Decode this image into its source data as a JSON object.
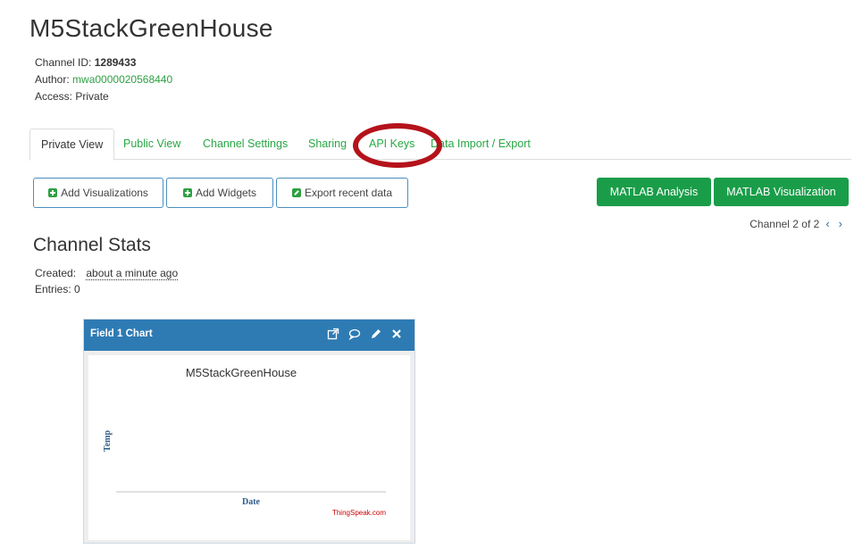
{
  "channel": {
    "title": "M5StackGreenHouse",
    "id_label": "Channel ID:",
    "id_value": "1289433",
    "author_label": "Author:",
    "author_value": "mwa0000020568440",
    "access_label": "Access:",
    "access_value": "Private"
  },
  "tabs": [
    {
      "label": "Private View",
      "active": true
    },
    {
      "label": "Public View"
    },
    {
      "label": "Channel Settings"
    },
    {
      "label": "Sharing"
    },
    {
      "label": "API Keys"
    },
    {
      "label": "Data Import / Export"
    }
  ],
  "toolbar": {
    "add_visualizations": "Add Visualizations",
    "add_widgets": "Add Widgets",
    "export_recent": "Export recent data",
    "matlab_analysis": "MATLAB Analysis",
    "matlab_visualization": "MATLAB Visualization"
  },
  "pager": {
    "text": "Channel 2 of 2",
    "prev_icon": "chevron-left-icon",
    "next_icon": "chevron-right-icon"
  },
  "stats": {
    "title": "Channel Stats",
    "created_label": "Created:",
    "created_value": "about a minute ago",
    "entries_label": "Entries:",
    "entries_value": "0"
  },
  "widget": {
    "header_title": "Field 1 Chart",
    "icons": [
      "external-link-icon",
      "comment-icon",
      "pencil-icon",
      "close-icon"
    ]
  },
  "chart_data": {
    "type": "line",
    "title": "M5StackGreenHouse",
    "xlabel": "Date",
    "ylabel": "Temp",
    "series": [],
    "credit": "ThingSpeak.com"
  },
  "colors": {
    "accent_green": "#1a9d49",
    "link_green": "#28a745",
    "header_blue": "#2e7bb4",
    "annotation_red": "#b5121b"
  }
}
